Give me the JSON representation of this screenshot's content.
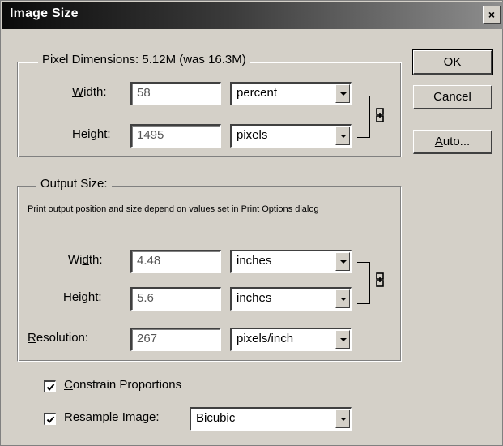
{
  "window": {
    "title": "Image Size",
    "close_symbol": "×"
  },
  "pixel_dimensions": {
    "legend": "Pixel Dimensions:  5.12M (was 16.3M)",
    "width": {
      "label": "Width:",
      "value": "58",
      "unit": "percent"
    },
    "height": {
      "label": "Height:",
      "value": "1495",
      "unit": "pixels"
    }
  },
  "output_size": {
    "legend": "Output Size:",
    "note": "Print output position and size depend on values set in Print Options dialog",
    "width": {
      "label": "Width:",
      "value": "4.48",
      "unit": "inches"
    },
    "height": {
      "label": "Height:",
      "value": "5.6",
      "unit": "inches"
    },
    "resolution": {
      "label": "Resolution:",
      "value": "267",
      "unit": "pixels/inch"
    }
  },
  "options": {
    "constrain": {
      "label": "Constrain Proportions",
      "checked": true
    },
    "resample": {
      "label": "Resample Image:",
      "checked": true,
      "method": "Bicubic"
    }
  },
  "buttons": {
    "ok": "OK",
    "cancel": "Cancel",
    "auto": "Auto..."
  }
}
